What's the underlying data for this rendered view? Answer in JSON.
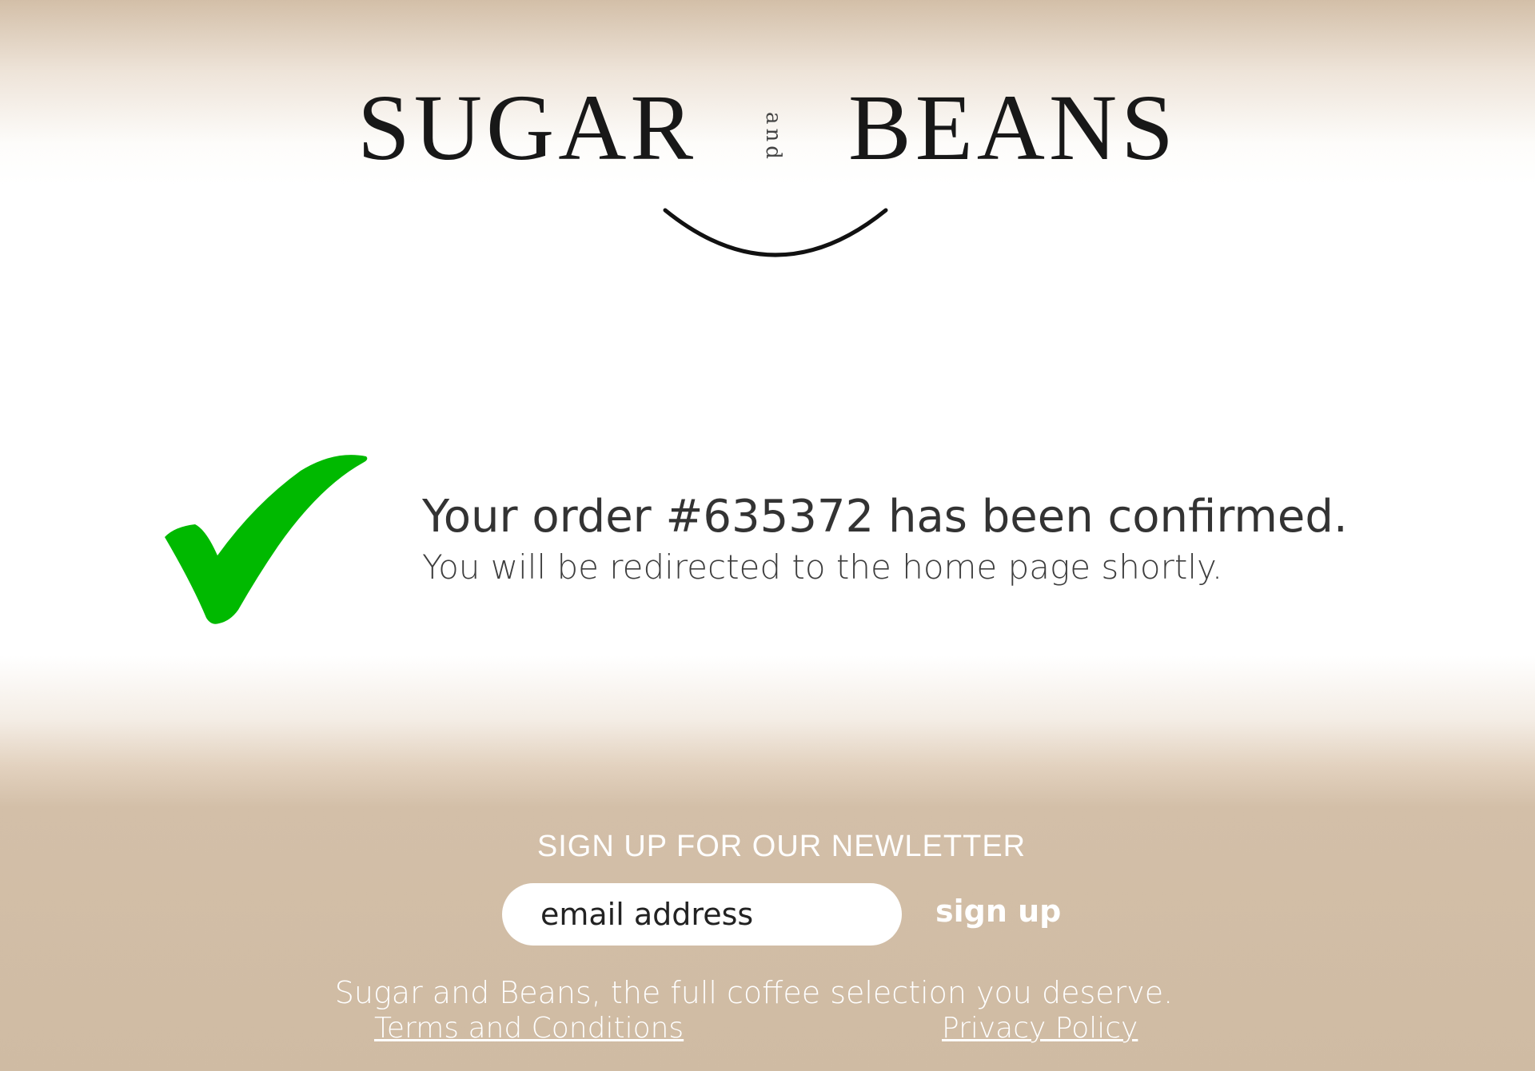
{
  "brand": {
    "name_left": "SUGAR",
    "name_connector": "and",
    "name_right": "BEANS"
  },
  "confirmation": {
    "headline": "Your order #635372 has been confirmed.",
    "subline": "You will be redirected to the home page shortly.",
    "check_color": "#00b900"
  },
  "newsletter": {
    "title": "SIGN UP FOR OUR NEWLETTER",
    "email_placeholder": "email address",
    "email_value": "",
    "signup_label": "sign up"
  },
  "footer": {
    "tagline": "Sugar and Beans, the full coffee selection you deserve.",
    "terms_label": "Terms and Conditions",
    "privacy_label": "Privacy Policy"
  },
  "colors": {
    "brand_tan": "#cfbba3",
    "text_dark": "#333333",
    "footer_text": "#ffffff"
  }
}
